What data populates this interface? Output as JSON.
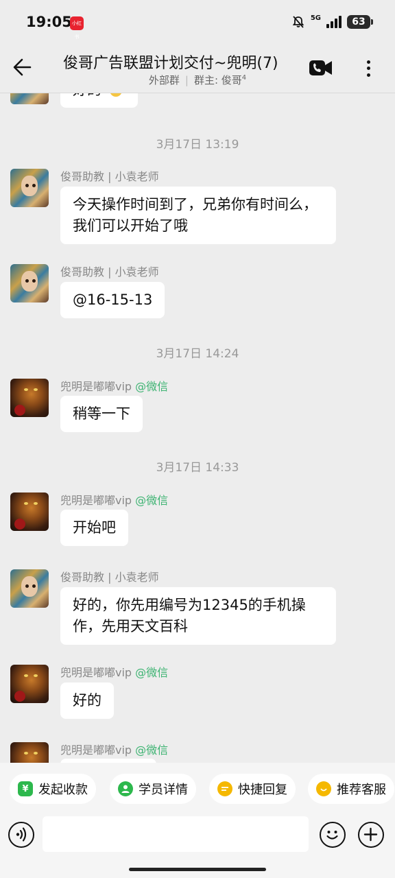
{
  "status_bar": {
    "time": "19:05",
    "app_badge": "小红书",
    "network": "5G",
    "battery": "63"
  },
  "header": {
    "title": "俊哥广告联盟计划交付~兜明(7)",
    "group_type": "外部群",
    "owner_label": "群主: 俊哥",
    "owner_sup": "4",
    "separator": "|"
  },
  "chat": {
    "partial_top_text": "好的",
    "messages": [
      {
        "type": "time",
        "text": "3月17日  13:19"
      },
      {
        "type": "msg",
        "avatar": "teacher-avatar",
        "sender": "俊哥助教 | 小袁老师",
        "source": "",
        "text": "今天操作时间到了，兄弟你有时间么，我们可以开始了哦"
      },
      {
        "type": "msg",
        "avatar": "teacher-avatar",
        "sender": "俊哥助教 | 小袁老师",
        "source": "",
        "text": "@16-15-13"
      },
      {
        "type": "time",
        "text": "3月17日  14:24"
      },
      {
        "type": "msg",
        "avatar": "tiger-avatar",
        "sender": "兜明是嘟嘟vip",
        "source": "@微信",
        "text": "稍等一下"
      },
      {
        "type": "time",
        "text": "3月17日  14:33"
      },
      {
        "type": "msg",
        "avatar": "tiger-avatar",
        "sender": "兜明是嘟嘟vip",
        "source": "@微信",
        "text": "开始吧"
      },
      {
        "type": "msg",
        "avatar": "teacher-avatar",
        "sender": "俊哥助教 | 小袁老师",
        "source": "",
        "text": "好的，你先用编号为12345的手机操作，先用天文百科"
      },
      {
        "type": "msg",
        "avatar": "tiger-avatar",
        "sender": "兜明是嘟嘟vip",
        "source": "@微信",
        "text": "好的"
      },
      {
        "type": "msg",
        "avatar": "tiger-avatar",
        "sender": "兜明是嘟嘟vip",
        "source": "@微信",
        "text": ""
      }
    ]
  },
  "quick_actions": [
    {
      "label": "发起收款",
      "icon": "yuan-icon",
      "color": "#2db84d"
    },
    {
      "label": "学员详情",
      "icon": "user-icon",
      "color": "#2db84d"
    },
    {
      "label": "快捷回复",
      "icon": "reply-icon",
      "color": "#f5b800"
    },
    {
      "label": "推荐客服",
      "icon": "service-icon",
      "color": "#f5b800"
    }
  ],
  "input": {
    "placeholder": ""
  }
}
